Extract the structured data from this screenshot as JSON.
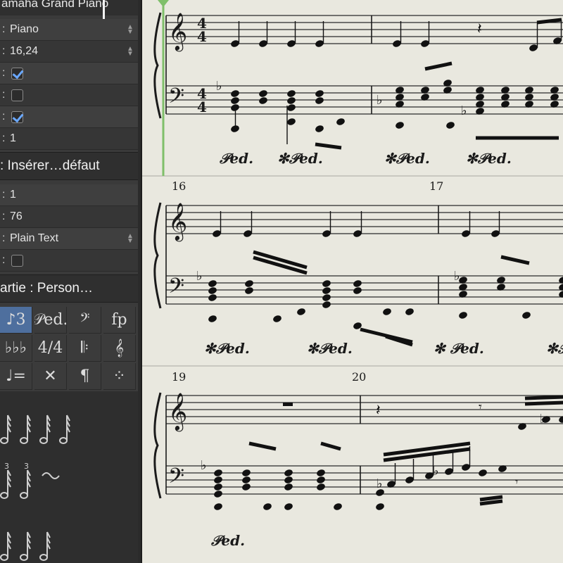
{
  "inspector": {
    "instrument_title": "amaha Grand Piano",
    "rows1": [
      {
        "value": "Piano",
        "type": "select"
      },
      {
        "value": "16,24",
        "type": "select"
      },
      {
        "value": "",
        "type": "checkbox",
        "checked": true
      },
      {
        "value": "",
        "type": "checkbox",
        "checked": false
      },
      {
        "value": "",
        "type": "checkbox",
        "checked": true
      },
      {
        "value": "1",
        "type": "text"
      }
    ],
    "section_insert": ": Insérer…défaut",
    "rows2": [
      {
        "value": "1",
        "type": "text"
      },
      {
        "value": "76",
        "type": "text"
      },
      {
        "value": "Plain Text",
        "type": "select"
      },
      {
        "value": "",
        "type": "checkbox",
        "checked": false
      }
    ],
    "section_part": "artie : Person…",
    "palette": [
      {
        "label": "♪3",
        "name": "tuplet-icon",
        "selected": true
      },
      {
        "label": "𝒫ed.",
        "name": "pedal-icon",
        "selected": false
      },
      {
        "label": "𝄢",
        "name": "bass-clef-icon",
        "selected": false
      },
      {
        "label": "fp",
        "name": "fortepiano-icon",
        "selected": false
      },
      {
        "label": "♭♭♭",
        "name": "key-signature-icon",
        "selected": false
      },
      {
        "label": "4/4",
        "name": "time-signature-icon",
        "selected": false
      },
      {
        "label": "𝄆",
        "name": "repeat-icon",
        "selected": false
      },
      {
        "label": "𝄞",
        "name": "ornament-icon",
        "selected": false
      },
      {
        "label": "♩=",
        "name": "tempo-icon",
        "selected": false
      },
      {
        "label": "✕",
        "name": "crescendo-icon",
        "selected": false
      },
      {
        "label": "¶",
        "name": "text-icon",
        "selected": false
      },
      {
        "label": "⁘",
        "name": "chord-grid-icon",
        "selected": false
      }
    ]
  },
  "score": {
    "measure_numbers": [
      "16",
      "17",
      "19",
      "20"
    ],
    "time_signature": "4/4",
    "pedal_marks": [
      "𝒫ed.",
      "✻𝒫ed.",
      "✻𝒫ed.",
      "✻𝒫ed.",
      "✻𝒫ed.",
      "✻𝒫ed.",
      "✻ 𝒫ed.",
      "✻𝒫e",
      "𝒫ed."
    ]
  },
  "colors": {
    "playhead": "#7fbf6a",
    "accent_select": "#4e6f9e",
    "paper": "#e9e8df"
  }
}
